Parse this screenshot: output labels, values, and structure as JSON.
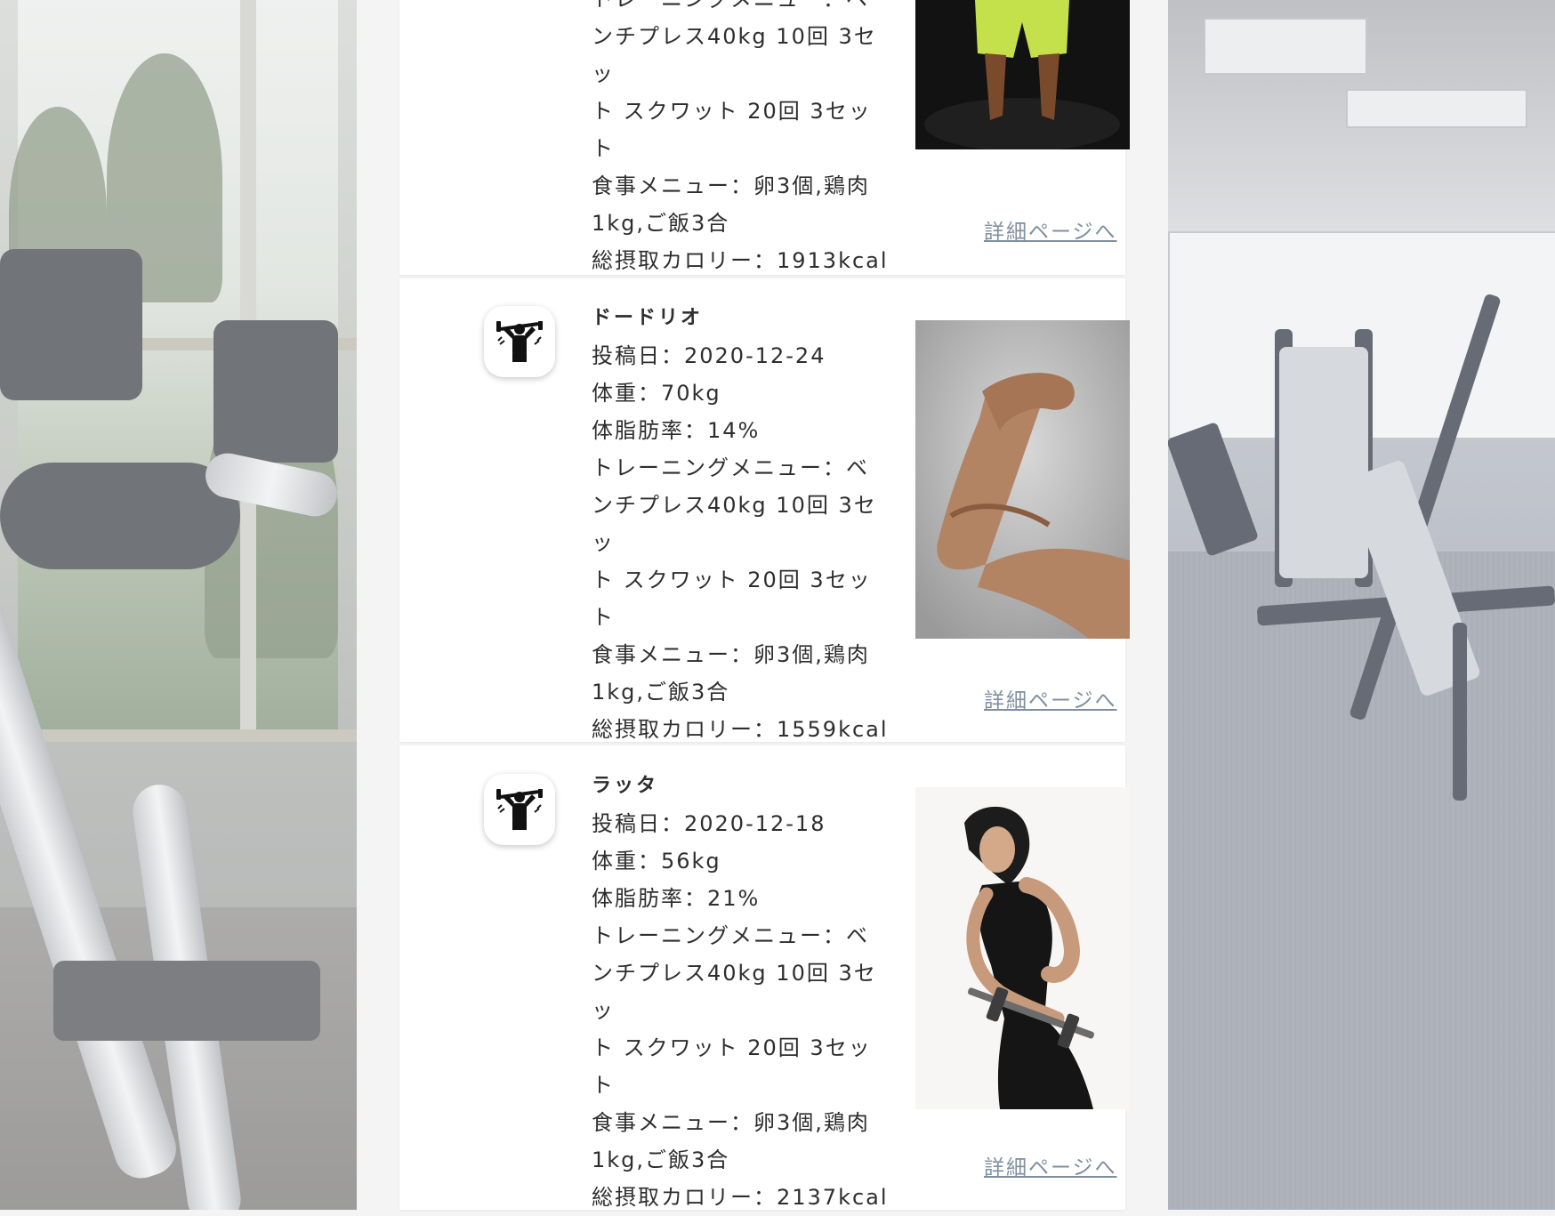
{
  "posts": [
    {
      "name": "",
      "lines": [
        "トレーニングメニュー：ベ",
        "ンチプレス40kg 10回 3セッ",
        "ト スクワット 20回 3セット",
        "食事メニュー：卵3個,鶏肉",
        "1kg,ご飯3合",
        "総摂取カロリー：1913kcal"
      ],
      "link": "詳細ページへ"
    },
    {
      "name": "ドードリオ",
      "lines": [
        "投稿日：2020-12-24",
        "体重：70kg",
        "体脂肪率：14%",
        "トレーニングメニュー：ベ",
        "ンチプレス40kg 10回 3セッ",
        "ト スクワット 20回 3セット",
        "食事メニュー：卵3個,鶏肉",
        "1kg,ご飯3合",
        "総摂取カロリー：1559kcal"
      ],
      "link": "詳細ページへ"
    },
    {
      "name": "ラッタ",
      "lines": [
        "投稿日：2020-12-18",
        "体重：56kg",
        "体脂肪率：21%",
        "トレーニングメニュー：ベ",
        "ンチプレス40kg 10回 3セッ",
        "ト スクワット 20回 3セット",
        "食事メニュー：卵3個,鶏肉",
        "1kg,ご飯3合",
        "総摂取カロリー：2137kcal"
      ],
      "link": "詳細ページへ"
    }
  ],
  "icons": {
    "avatar": "weightlifter-icon"
  },
  "colors": {
    "page_bg": "#f4f4f5",
    "card_bg": "#ffffff",
    "link": "#7f8fa0",
    "text": "#2e2e2e"
  }
}
